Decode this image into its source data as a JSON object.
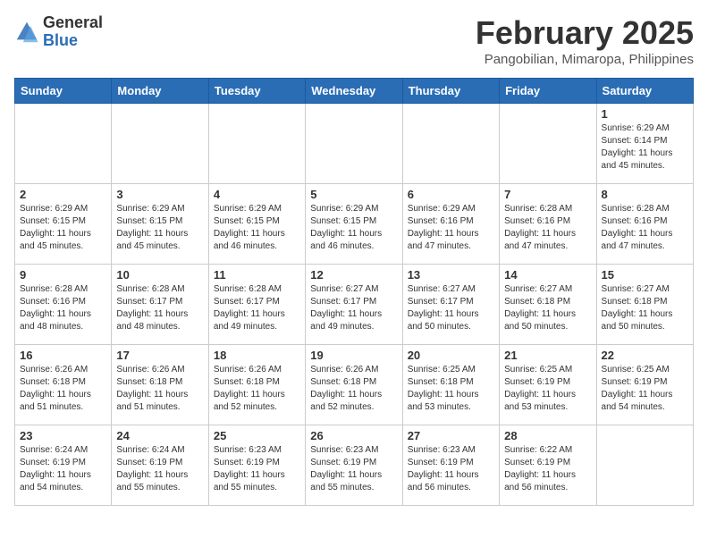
{
  "header": {
    "logo_general": "General",
    "logo_blue": "Blue",
    "month_title": "February 2025",
    "subtitle": "Pangobilian, Mimaropa, Philippines"
  },
  "days_of_week": [
    "Sunday",
    "Monday",
    "Tuesday",
    "Wednesday",
    "Thursday",
    "Friday",
    "Saturday"
  ],
  "weeks": [
    [
      null,
      null,
      null,
      null,
      null,
      null,
      {
        "day": "1",
        "sunrise": "Sunrise: 6:29 AM",
        "sunset": "Sunset: 6:14 PM",
        "daylight": "Daylight: 11 hours and 45 minutes."
      }
    ],
    [
      {
        "day": "2",
        "sunrise": "Sunrise: 6:29 AM",
        "sunset": "Sunset: 6:15 PM",
        "daylight": "Daylight: 11 hours and 45 minutes."
      },
      {
        "day": "3",
        "sunrise": "Sunrise: 6:29 AM",
        "sunset": "Sunset: 6:15 PM",
        "daylight": "Daylight: 11 hours and 45 minutes."
      },
      {
        "day": "4",
        "sunrise": "Sunrise: 6:29 AM",
        "sunset": "Sunset: 6:15 PM",
        "daylight": "Daylight: 11 hours and 46 minutes."
      },
      {
        "day": "5",
        "sunrise": "Sunrise: 6:29 AM",
        "sunset": "Sunset: 6:15 PM",
        "daylight": "Daylight: 11 hours and 46 minutes."
      },
      {
        "day": "6",
        "sunrise": "Sunrise: 6:29 AM",
        "sunset": "Sunset: 6:16 PM",
        "daylight": "Daylight: 11 hours and 47 minutes."
      },
      {
        "day": "7",
        "sunrise": "Sunrise: 6:28 AM",
        "sunset": "Sunset: 6:16 PM",
        "daylight": "Daylight: 11 hours and 47 minutes."
      },
      {
        "day": "8",
        "sunrise": "Sunrise: 6:28 AM",
        "sunset": "Sunset: 6:16 PM",
        "daylight": "Daylight: 11 hours and 47 minutes."
      }
    ],
    [
      {
        "day": "9",
        "sunrise": "Sunrise: 6:28 AM",
        "sunset": "Sunset: 6:16 PM",
        "daylight": "Daylight: 11 hours and 48 minutes."
      },
      {
        "day": "10",
        "sunrise": "Sunrise: 6:28 AM",
        "sunset": "Sunset: 6:17 PM",
        "daylight": "Daylight: 11 hours and 48 minutes."
      },
      {
        "day": "11",
        "sunrise": "Sunrise: 6:28 AM",
        "sunset": "Sunset: 6:17 PM",
        "daylight": "Daylight: 11 hours and 49 minutes."
      },
      {
        "day": "12",
        "sunrise": "Sunrise: 6:27 AM",
        "sunset": "Sunset: 6:17 PM",
        "daylight": "Daylight: 11 hours and 49 minutes."
      },
      {
        "day": "13",
        "sunrise": "Sunrise: 6:27 AM",
        "sunset": "Sunset: 6:17 PM",
        "daylight": "Daylight: 11 hours and 50 minutes."
      },
      {
        "day": "14",
        "sunrise": "Sunrise: 6:27 AM",
        "sunset": "Sunset: 6:18 PM",
        "daylight": "Daylight: 11 hours and 50 minutes."
      },
      {
        "day": "15",
        "sunrise": "Sunrise: 6:27 AM",
        "sunset": "Sunset: 6:18 PM",
        "daylight": "Daylight: 11 hours and 50 minutes."
      }
    ],
    [
      {
        "day": "16",
        "sunrise": "Sunrise: 6:26 AM",
        "sunset": "Sunset: 6:18 PM",
        "daylight": "Daylight: 11 hours and 51 minutes."
      },
      {
        "day": "17",
        "sunrise": "Sunrise: 6:26 AM",
        "sunset": "Sunset: 6:18 PM",
        "daylight": "Daylight: 11 hours and 51 minutes."
      },
      {
        "day": "18",
        "sunrise": "Sunrise: 6:26 AM",
        "sunset": "Sunset: 6:18 PM",
        "daylight": "Daylight: 11 hours and 52 minutes."
      },
      {
        "day": "19",
        "sunrise": "Sunrise: 6:26 AM",
        "sunset": "Sunset: 6:18 PM",
        "daylight": "Daylight: 11 hours and 52 minutes."
      },
      {
        "day": "20",
        "sunrise": "Sunrise: 6:25 AM",
        "sunset": "Sunset: 6:18 PM",
        "daylight": "Daylight: 11 hours and 53 minutes."
      },
      {
        "day": "21",
        "sunrise": "Sunrise: 6:25 AM",
        "sunset": "Sunset: 6:19 PM",
        "daylight": "Daylight: 11 hours and 53 minutes."
      },
      {
        "day": "22",
        "sunrise": "Sunrise: 6:25 AM",
        "sunset": "Sunset: 6:19 PM",
        "daylight": "Daylight: 11 hours and 54 minutes."
      }
    ],
    [
      {
        "day": "23",
        "sunrise": "Sunrise: 6:24 AM",
        "sunset": "Sunset: 6:19 PM",
        "daylight": "Daylight: 11 hours and 54 minutes."
      },
      {
        "day": "24",
        "sunrise": "Sunrise: 6:24 AM",
        "sunset": "Sunset: 6:19 PM",
        "daylight": "Daylight: 11 hours and 55 minutes."
      },
      {
        "day": "25",
        "sunrise": "Sunrise: 6:23 AM",
        "sunset": "Sunset: 6:19 PM",
        "daylight": "Daylight: 11 hours and 55 minutes."
      },
      {
        "day": "26",
        "sunrise": "Sunrise: 6:23 AM",
        "sunset": "Sunset: 6:19 PM",
        "daylight": "Daylight: 11 hours and 55 minutes."
      },
      {
        "day": "27",
        "sunrise": "Sunrise: 6:23 AM",
        "sunset": "Sunset: 6:19 PM",
        "daylight": "Daylight: 11 hours and 56 minutes."
      },
      {
        "day": "28",
        "sunrise": "Sunrise: 6:22 AM",
        "sunset": "Sunset: 6:19 PM",
        "daylight": "Daylight: 11 hours and 56 minutes."
      },
      null
    ]
  ]
}
